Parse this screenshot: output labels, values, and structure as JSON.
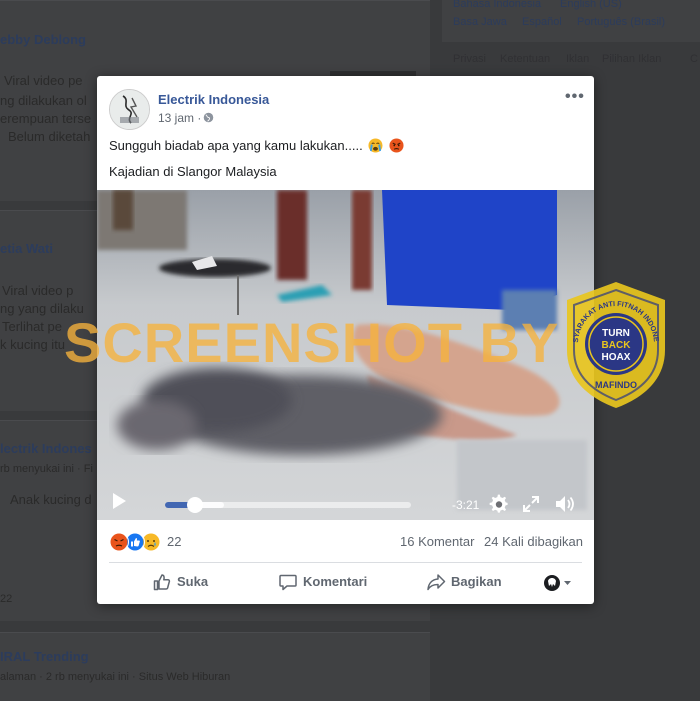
{
  "background": {
    "feed": [
      {
        "name": "ebby Deblong",
        "lines": [
          "Viral video pe",
          "ng dilakukan ol",
          "erempuan terse",
          "Belum diketah"
        ]
      },
      {
        "name": "etia Wati",
        "lines": [
          "Viral video p",
          "ng yang dilaku",
          "Terlihat pe",
          "k kucing itu"
        ]
      },
      {
        "name": "lectrik Indones",
        "meta": "rb menyukai ini · Fi",
        "lines": [
          "Anak kucing d"
        ]
      },
      {
        "name": "IRAL Trending",
        "meta": "alaman · 2 rb menyukai ini · Situs Web Hiburan"
      }
    ],
    "footnote": "22",
    "languages": [
      "Bahasa Indonesia",
      "English (US)",
      "Basa Jawa",
      "Español",
      "Português (Brasil)"
    ],
    "footer_links": [
      "Privasi",
      "Ketentuan",
      "Iklan",
      "Pilihan Iklan",
      "C"
    ]
  },
  "post": {
    "page_name": "Electrik Indonesia",
    "avatar_text": "Electrik Indo",
    "time": "13 jam",
    "dot": "·",
    "more_label": "•••",
    "text_line1": "Sungguh biadab apa yang kamu lakukan.....",
    "text_line2": "Kajadian di Slangor Malaysia",
    "video": {
      "remaining": "-3:21",
      "progress": 0.12,
      "buffered": 0.24
    },
    "watermark": "SCREENSHOT BY",
    "badge": {
      "ring_text": "MASYARAKAT ANTI FITNAH INDONESIA",
      "bottom_text": "MAFINDO",
      "center_top": "TURN",
      "center_mid": "BACK",
      "center_bot": "HOAX"
    },
    "reaction_count": "22",
    "comments": "16 Komentar",
    "shares": "24 Kali dibagikan",
    "actions": {
      "like": "Suka",
      "comment": "Komentari",
      "share": "Bagikan"
    },
    "colors": {
      "link": "#385898",
      "accent": "#4267b2",
      "watermark": "#f6b23c",
      "badge": "#e8c51e"
    }
  }
}
